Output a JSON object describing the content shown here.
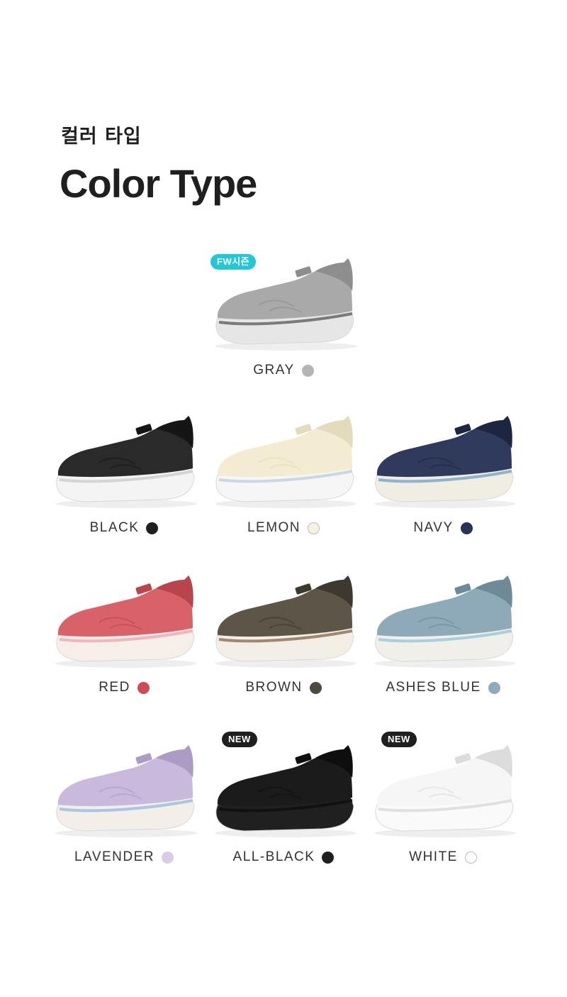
{
  "header": {
    "subtitle": "컬러 타입",
    "title": "Color Type"
  },
  "products": [
    {
      "label": "GRAY",
      "swatch": "#b5b5b5",
      "upper": "#a9a9a9",
      "upper_dark": "#8e8e8e",
      "sole": "#e6e6e6",
      "sole_line": "#7a7a7a",
      "badge": "FW시즌",
      "badge_color": "#22c8d8"
    },
    {
      "label": "BLACK",
      "swatch": "#1f1f1f",
      "upper": "#2a2a2a",
      "upper_dark": "#151515",
      "sole": "#f4f4f4",
      "sole_line": "#d5d5d5",
      "badge": null,
      "badge_color": null
    },
    {
      "label": "LEMON",
      "swatch": "#f7f2dd",
      "upper": "#f3ecd2",
      "upper_dark": "#e3dbbd",
      "sole": "#f6f6f6",
      "sole_line": "#c9d9e4",
      "badge": null,
      "badge_color": null
    },
    {
      "label": "NAVY",
      "swatch": "#243357",
      "upper": "#2f3a5c",
      "upper_dark": "#1d2540",
      "sole": "#f0ede3",
      "sole_line": "#8fb3cf",
      "badge": null,
      "badge_color": null
    },
    {
      "label": "RED",
      "swatch": "#d04a55",
      "upper": "#d9626a",
      "upper_dark": "#b8454e",
      "sole": "#f6efe8",
      "sole_line": "#f2b4bf",
      "badge": null,
      "badge_color": null
    },
    {
      "label": "BROWN",
      "swatch": "#4e4a3e",
      "upper": "#5c5548",
      "upper_dark": "#3d3830",
      "sole": "#f3efe6",
      "sole_line": "#a08870",
      "badge": null,
      "badge_color": null
    },
    {
      "label": "ASHES BLUE",
      "swatch": "#8eaabb",
      "upper": "#8ea9b8",
      "upper_dark": "#6e8a99",
      "sole": "#f1efe9",
      "sole_line": "#a8cfe0",
      "badge": null,
      "badge_color": null
    },
    {
      "label": "LAVENDER",
      "swatch": "#d9cde6",
      "upper": "#c9b9dd",
      "upper_dark": "#ac9cc4",
      "sole": "#f3efe8",
      "sole_line": "#a9c6e2",
      "badge": null,
      "badge_color": null
    },
    {
      "label": "ALL-BLACK",
      "swatch": "#1f1f1f",
      "upper": "#1b1b1b",
      "upper_dark": "#0e0e0e",
      "sole": "#202020",
      "sole_line": "#111111",
      "badge": "NEW",
      "badge_color": "#1f1f1f"
    },
    {
      "label": "WHITE",
      "swatch": "#ffffff",
      "upper": "#f6f6f6",
      "upper_dark": "#dcdcdc",
      "sole": "#fafafa",
      "sole_line": "#e0e0e0",
      "badge": "NEW",
      "badge_color": "#1f1f1f"
    }
  ]
}
